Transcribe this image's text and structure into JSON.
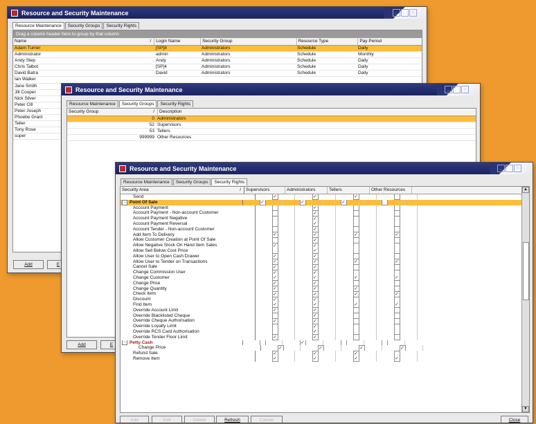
{
  "window1": {
    "title": "Resource and Security Maintenance",
    "tabs": [
      "Resource Maintenance",
      "Security Groups",
      "Security Rights"
    ],
    "group_hint": "Drag a column header here to group by that column",
    "columns": [
      "Name",
      "Login Name",
      "Security Group",
      "Resource Type",
      "Pay Period"
    ],
    "rows": [
      [
        "Adam Turner",
        "[SP]8",
        "Administrators",
        "Schedule",
        "Daily"
      ],
      [
        "Administrator",
        "admin",
        "Administrators",
        "Schedule",
        "Monthly"
      ],
      [
        "Andy Step",
        "Andy",
        "Administrators",
        "Schedule",
        "Daily"
      ],
      [
        "Chris Talbot",
        "[SP]4",
        "Administrators",
        "Schedule",
        "Daily"
      ],
      [
        "David Batra",
        "David",
        "Administrators",
        "Schedule",
        "Daily"
      ],
      [
        "Ian Walker",
        "",
        "",
        "",
        ""
      ],
      [
        "Jane Smith",
        "",
        "",
        "",
        ""
      ],
      [
        "Jill Cooper",
        "",
        "",
        "",
        ""
      ],
      [
        "Nick Silver",
        "",
        "",
        "",
        ""
      ],
      [
        "Peter Cill",
        "",
        "",
        "",
        ""
      ],
      [
        "Peter Joseph",
        "",
        "",
        "",
        ""
      ],
      [
        "Phoebe Grant",
        "",
        "",
        "",
        ""
      ],
      [
        "Teller",
        "",
        "",
        "",
        ""
      ],
      [
        "Tony Rose",
        "",
        "",
        "",
        ""
      ],
      [
        "super",
        "",
        "",
        "",
        ""
      ]
    ],
    "add_label": "Add",
    "edit_label": "E"
  },
  "window2": {
    "title": "Resource and Security Maintenance",
    "tabs": [
      "Resource Maintenance",
      "Security Groups",
      "Security Rights"
    ],
    "columns": [
      "Security Group",
      "Description"
    ],
    "rows": [
      [
        "0",
        "Administrators"
      ],
      [
        "52",
        "Supervisors"
      ],
      [
        "53",
        "Tellers"
      ],
      [
        "999999",
        "Other Resources"
      ]
    ],
    "add_label": "Add",
    "edit_label": "E"
  },
  "window3": {
    "title": "Resource and Security Maintenance",
    "tabs": [
      "Resource Maintenance",
      "Security Groups",
      "Security Rights"
    ],
    "columns": [
      "Security Area",
      "Supervisors",
      "Administrators",
      "Tellers",
      "Other Resources"
    ],
    "rows": [
      {
        "name": "Send",
        "kind": "item",
        "c": [
          1,
          1,
          1,
          0
        ]
      },
      {
        "name": "Point Of Sale",
        "kind": "cat",
        "c": [
          1,
          1,
          1,
          0
        ]
      },
      {
        "name": "Account Payment",
        "kind": "item",
        "c": [
          0,
          1,
          0,
          0
        ]
      },
      {
        "name": "Account Payment - Non-account Customer",
        "kind": "item",
        "c": [
          0,
          1,
          0,
          0
        ]
      },
      {
        "name": "Account Payment Negative",
        "kind": "item",
        "c": [
          0,
          1,
          0,
          0
        ]
      },
      {
        "name": "Account Payment Reversal",
        "kind": "item",
        "c": [
          0,
          1,
          0,
          0
        ]
      },
      {
        "name": "Account Tender - Non-account Customer",
        "kind": "item",
        "c": [
          0,
          1,
          0,
          0
        ]
      },
      {
        "name": "Add Item To Delivery",
        "kind": "item",
        "c": [
          1,
          1,
          1,
          1
        ]
      },
      {
        "name": "Allow Customer Creation at Point Of Sale",
        "kind": "item",
        "c": [
          0,
          1,
          0,
          0
        ]
      },
      {
        "name": "Allow Negative Stock On Hand Item Sales",
        "kind": "item",
        "c": [
          1,
          1,
          0,
          0
        ]
      },
      {
        "name": "Allow Sell Below Cost Price",
        "kind": "item",
        "c": [
          0,
          1,
          0,
          0
        ]
      },
      {
        "name": "Allow User to Open Cash Drawer",
        "kind": "item",
        "c": [
          1,
          1,
          0,
          0
        ]
      },
      {
        "name": "Allow User to Tender on Transactions",
        "kind": "item",
        "c": [
          1,
          1,
          1,
          1
        ]
      },
      {
        "name": "Cancel Sale",
        "kind": "item",
        "c": [
          1,
          1,
          0,
          0
        ]
      },
      {
        "name": "Change Commission User",
        "kind": "item",
        "c": [
          1,
          1,
          0,
          0
        ]
      },
      {
        "name": "Change Customer",
        "kind": "item",
        "c": [
          1,
          1,
          1,
          1
        ]
      },
      {
        "name": "Change Price",
        "kind": "item",
        "c": [
          1,
          1,
          0,
          0
        ]
      },
      {
        "name": "Change Quantity",
        "kind": "item",
        "c": [
          1,
          1,
          1,
          0
        ]
      },
      {
        "name": "Check Item",
        "kind": "item",
        "c": [
          1,
          1,
          1,
          1
        ]
      },
      {
        "name": "Discount",
        "kind": "item",
        "c": [
          1,
          1,
          0,
          0
        ]
      },
      {
        "name": "Find Item",
        "kind": "item",
        "c": [
          1,
          1,
          1,
          1
        ]
      },
      {
        "name": "Override Account Limit",
        "kind": "item",
        "c": [
          1,
          1,
          0,
          0
        ]
      },
      {
        "name": "Override Blacklisted Cheque",
        "kind": "item",
        "c": [
          0,
          1,
          0,
          0
        ]
      },
      {
        "name": "Override Cheque Authorisation",
        "kind": "item",
        "c": [
          1,
          1,
          0,
          0
        ]
      },
      {
        "name": "Override Loyalty Limit",
        "kind": "item",
        "c": [
          0,
          1,
          0,
          0
        ]
      },
      {
        "name": "Override RCS Card Authorisation",
        "kind": "item",
        "c": [
          0,
          1,
          0,
          0
        ]
      },
      {
        "name": "Override Tender Floor Limit",
        "kind": "item",
        "c": [
          1,
          1,
          0,
          0
        ]
      },
      {
        "name": "Petty Cash",
        "kind": "sub",
        "c": [
          0,
          1,
          0,
          0
        ]
      },
      {
        "name": "Change Price",
        "kind": "subitem",
        "c": [
          1,
          1,
          1,
          1
        ]
      },
      {
        "name": "Refund Sale",
        "kind": "item",
        "c": [
          1,
          1,
          1,
          0
        ]
      },
      {
        "name": "Remove Item",
        "kind": "item",
        "c": [
          1,
          1,
          1,
          1
        ]
      }
    ],
    "buttons": {
      "add": "Add",
      "edit": "Edit",
      "delete": "Delete",
      "refresh": "Refresh",
      "cancel": "Cancel",
      "close": "Close"
    }
  },
  "colors": {
    "background": "#ee9a2e",
    "titlebar": "#1f2a6e",
    "selection": "#fcbd3b",
    "sub_category_text": "#b31212"
  },
  "icons": {
    "expand": "minus-box-icon",
    "check": "check-icon",
    "sort": "sort-indicator-icon"
  }
}
